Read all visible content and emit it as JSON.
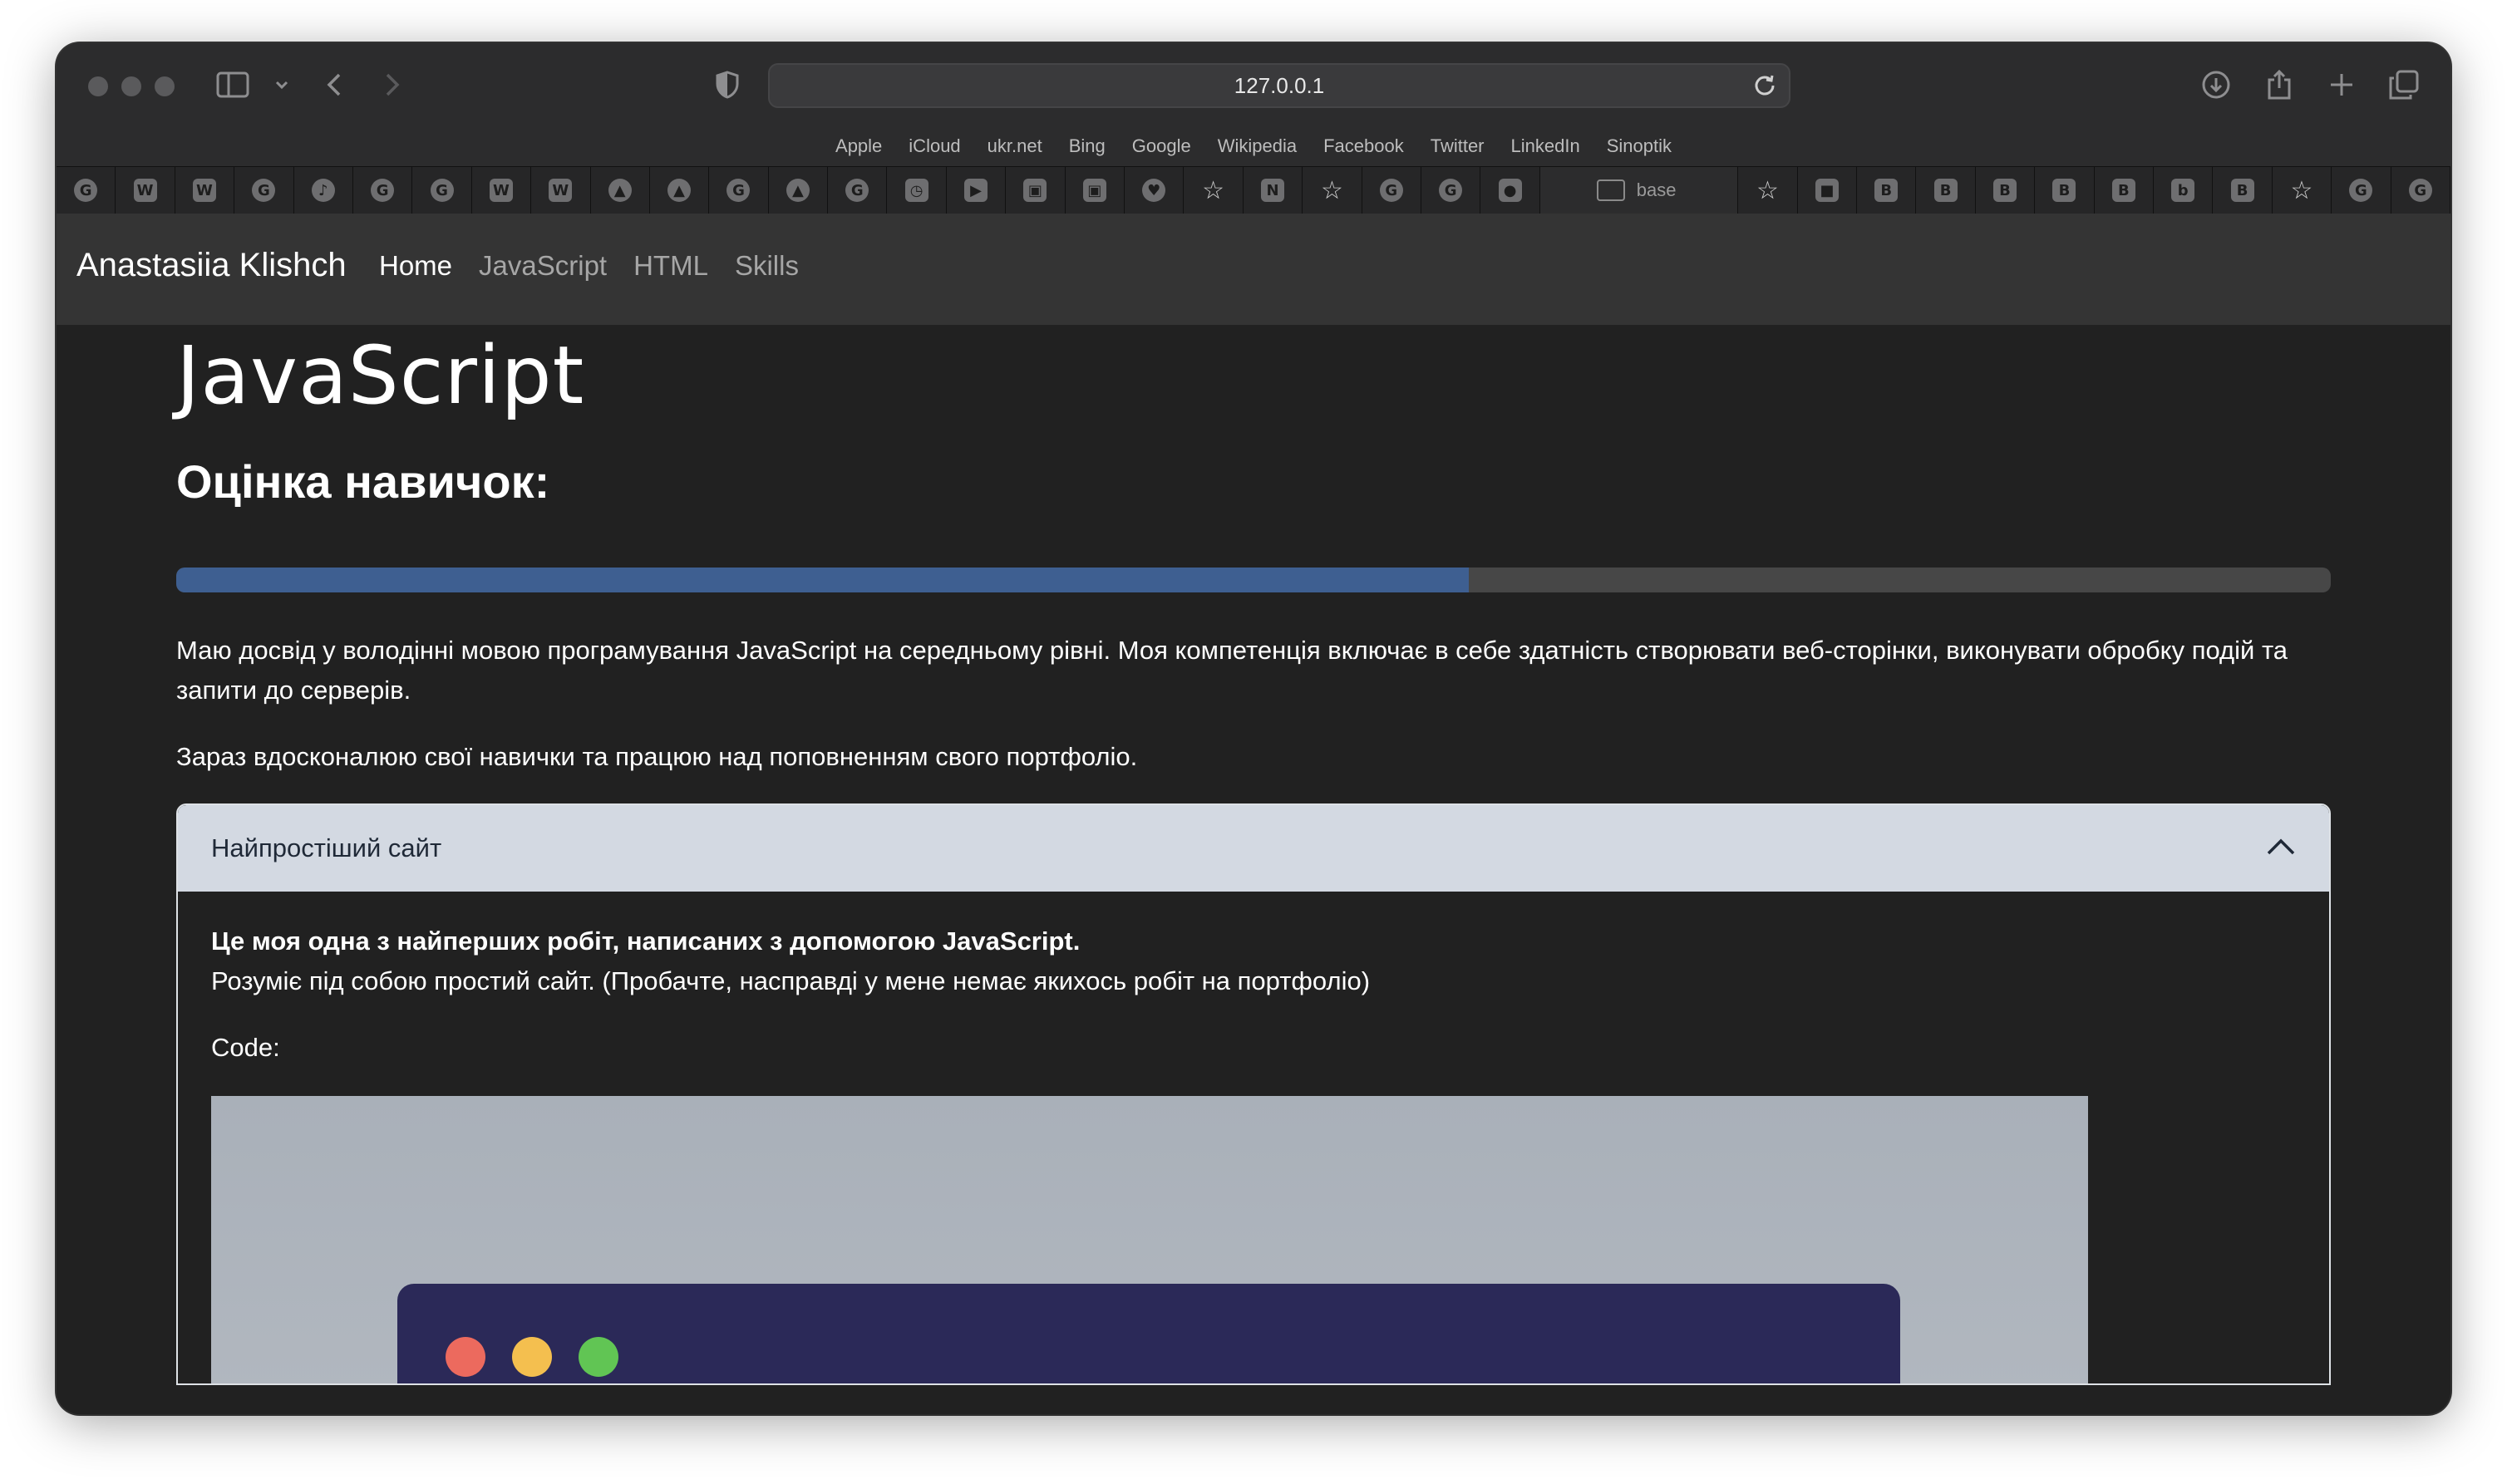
{
  "browser": {
    "url": "127.0.0.1",
    "favorites": [
      "Apple",
      "iCloud",
      "ukr.net",
      "Bing",
      "Google",
      "Wikipedia",
      "Facebook",
      "Twitter",
      "LinkedIn",
      "Sinoptik"
    ],
    "tabs_before": [
      {
        "icon": "grammarly-icon",
        "glyph": "G"
      },
      {
        "icon": "webflow-icon",
        "glyph": "W",
        "shape": "sq"
      },
      {
        "icon": "webflow-icon",
        "glyph": "W",
        "shape": "sq"
      },
      {
        "icon": "grammarly-icon",
        "glyph": "G"
      },
      {
        "icon": "tiktok-icon",
        "glyph": "♪"
      },
      {
        "icon": "grammarly-icon",
        "glyph": "G"
      },
      {
        "icon": "grammarly-icon",
        "glyph": "G"
      },
      {
        "icon": "webflow-icon",
        "glyph": "W",
        "shape": "sq"
      },
      {
        "icon": "webflow-icon",
        "glyph": "W",
        "shape": "sq"
      },
      {
        "icon": "drive-icon",
        "glyph": "▲"
      },
      {
        "icon": "drive-icon",
        "glyph": "▲"
      },
      {
        "icon": "grammarly-icon",
        "glyph": "G"
      },
      {
        "icon": "drive-icon",
        "glyph": "▲"
      },
      {
        "icon": "grammarly-icon",
        "glyph": "G"
      },
      {
        "icon": "clock-icon",
        "glyph": "◷",
        "shape": "sq"
      },
      {
        "icon": "youtube-icon",
        "glyph": "▶",
        "shape": "sq"
      },
      {
        "icon": "image-icon",
        "glyph": "▣",
        "shape": "sq"
      },
      {
        "icon": "contact-icon",
        "glyph": "▣",
        "shape": "sq"
      },
      {
        "icon": "heart-icon",
        "glyph": "♥"
      },
      {
        "icon": "star-icon",
        "glyph": "☆",
        "shape": "star"
      },
      {
        "icon": "bookmark-icon",
        "glyph": "N",
        "shape": "sq"
      },
      {
        "icon": "star-icon",
        "glyph": "☆",
        "shape": "star"
      },
      {
        "icon": "grammarly-icon",
        "glyph": "G"
      },
      {
        "icon": "grammarly-icon",
        "glyph": "G"
      },
      {
        "icon": "github-icon",
        "glyph": "●",
        "shape": "sq"
      }
    ],
    "active_tab": {
      "icon": "terminal-icon",
      "label": "base"
    },
    "tabs_after": [
      {
        "icon": "star-icon",
        "glyph": "☆",
        "shape": "star"
      },
      {
        "icon": "video-icon",
        "glyph": "■",
        "shape": "sq"
      },
      {
        "icon": "bootstrap-icon",
        "glyph": "B",
        "shape": "sq"
      },
      {
        "icon": "bootstrap-icon",
        "glyph": "B",
        "shape": "sq"
      },
      {
        "icon": "bootstrap-icon",
        "glyph": "B",
        "shape": "sq"
      },
      {
        "icon": "bootstrap-icon",
        "glyph": "B",
        "shape": "sq"
      },
      {
        "icon": "bootstrap-icon",
        "glyph": "B",
        "shape": "sq"
      },
      {
        "icon": "bootstrap-icon",
        "glyph": "b",
        "shape": "sq"
      },
      {
        "icon": "bootstrap-icon",
        "glyph": "B",
        "shape": "sq"
      },
      {
        "icon": "star-icon",
        "glyph": "☆",
        "shape": "star"
      },
      {
        "icon": "grammarly-icon",
        "glyph": "G"
      },
      {
        "icon": "grammarly-icon",
        "glyph": "G"
      }
    ]
  },
  "site": {
    "brand": "Anastasiia Klishch",
    "nav": [
      {
        "label": "Home",
        "active": true
      },
      {
        "label": "JavaScript",
        "active": false
      },
      {
        "label": "HTML",
        "active": false
      },
      {
        "label": "Skills",
        "active": false
      }
    ]
  },
  "main": {
    "title": "JavaScript",
    "skills_heading": "Оцінка навичок:",
    "progress_percent": 60,
    "paragraph1": "Маю досвід у володінні мовою програмування JavaScript на середньому рівні. Моя компетенція включає в себе здатність створювати веб-сторінки, виконувати обробку подій та запити до серверів.",
    "paragraph2": "Зараз вдосконалюю свої навички та працюю над поповненням свого портфоліо.",
    "accordion": {
      "title": "Найпростіший сайт",
      "bold_line": "Це моя одна з найперших робіт, написаних з допомогою JavaScript.",
      "description": "Розуміє під собою простий сайт. (Пробачте, насправді у мене немає якихось робіт на портфоліо)",
      "code_label": "Code:"
    }
  },
  "colors": {
    "progress_fill": "#3e5f91",
    "preview_window": "#2b2958",
    "dot_red": "#ec6a5e",
    "dot_yellow": "#f4bf4f",
    "dot_green": "#61c554"
  }
}
